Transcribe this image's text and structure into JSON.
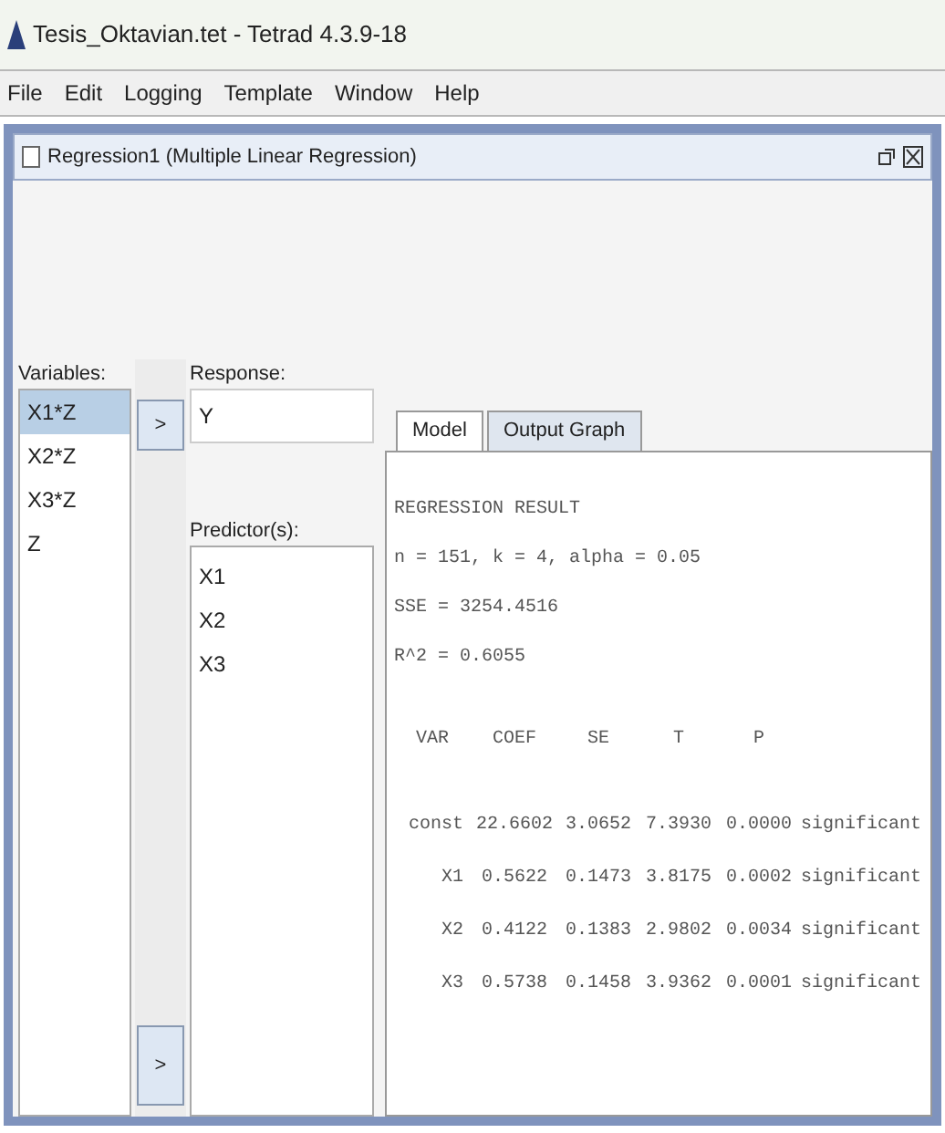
{
  "window": {
    "title": "Tesis_Oktavian.tet - Tetrad 4.3.9-18"
  },
  "menu": [
    "File",
    "Edit",
    "Logging",
    "Template",
    "Window",
    "Help"
  ],
  "frame": {
    "title": "Regression1 (Multiple Linear Regression)"
  },
  "variables": {
    "label": "Variables:",
    "items": [
      {
        "text": "X1*Z",
        "selected": true
      },
      {
        "text": "X2*Z",
        "selected": false
      },
      {
        "text": "X3*Z",
        "selected": false
      },
      {
        "text": "Z",
        "selected": false
      }
    ]
  },
  "add_response_button": ">",
  "response": {
    "label": "Response:",
    "value": "Y"
  },
  "predictors": {
    "label": "Predictor(s):",
    "items": [
      "X1",
      "X2",
      "X3"
    ]
  },
  "add_predictor_button": ">",
  "tabs": [
    {
      "label": "Model",
      "selected": true
    },
    {
      "label": "Output Graph",
      "selected": false
    }
  ],
  "result": {
    "heading": "REGRESSION RESULT",
    "lines": [
      "n = 151, k = 4, alpha = 0.05",
      "SSE = 3254.4516",
      "R^2 = 0.6055"
    ],
    "columns": [
      "VAR",
      "COEF",
      "SE",
      "T",
      "P"
    ],
    "rows": [
      [
        "const",
        "22.6602",
        "3.0652",
        "7.3930",
        "0.0000",
        "significant"
      ],
      [
        "X1",
        "0.5622",
        "0.1473",
        "3.8175",
        "0.0002",
        "significant"
      ],
      [
        "X2",
        "0.4122",
        "0.1383",
        "2.9802",
        "0.0034",
        "significant"
      ],
      [
        "X3",
        "0.5738",
        "0.1458",
        "3.9362",
        "0.0001",
        "significant"
      ]
    ]
  }
}
